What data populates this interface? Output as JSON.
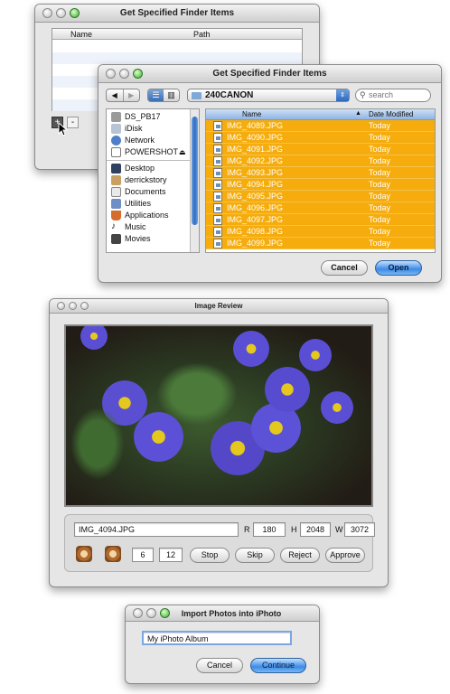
{
  "finder_back": {
    "title": "Get Specified Finder Items",
    "columns": [
      "Name",
      "Path"
    ],
    "add_button": "+",
    "remove_button": "-"
  },
  "finder_front": {
    "title": "Get Specified Finder Items",
    "location": "240CANON",
    "search_placeholder": "search",
    "sidebar_devices": [
      "DS_PB17",
      "iDisk",
      "Network",
      "POWERSHOT"
    ],
    "sidebar_places": [
      "Desktop",
      "derrickstory",
      "Documents",
      "Utilities",
      "Applications",
      "Music",
      "Movies"
    ],
    "col_name": "Name",
    "col_date": "Date Modified",
    "files": [
      {
        "name": "IMG_4089.JPG",
        "date": "Today"
      },
      {
        "name": "IMG_4090.JPG",
        "date": "Today"
      },
      {
        "name": "IMG_4091.JPG",
        "date": "Today"
      },
      {
        "name": "IMG_4092.JPG",
        "date": "Today"
      },
      {
        "name": "IMG_4093.JPG",
        "date": "Today"
      },
      {
        "name": "IMG_4094.JPG",
        "date": "Today"
      },
      {
        "name": "IMG_4095.JPG",
        "date": "Today"
      },
      {
        "name": "IMG_4096.JPG",
        "date": "Today"
      },
      {
        "name": "IMG_4097.JPG",
        "date": "Today"
      },
      {
        "name": "IMG_4098.JPG",
        "date": "Today"
      },
      {
        "name": "IMG_4099.JPG",
        "date": "Today"
      }
    ],
    "cancel": "Cancel",
    "open": "Open",
    "selection_color": "#f5ac0c"
  },
  "image_review": {
    "title": "Image Review",
    "filename": "IMG_4094.JPG",
    "r_label": "R",
    "r_value": "180",
    "h_label": "H",
    "h_value": "2048",
    "w_label": "W",
    "w_value": "3072",
    "index": "6",
    "total": "12",
    "stop": "Stop",
    "skip": "Skip",
    "reject": "Reject",
    "approve": "Approve"
  },
  "import_dialog": {
    "title": "Import Photos into iPhoto",
    "album_name": "My iPhoto Album",
    "cancel": "Cancel",
    "continue": "Continue"
  }
}
